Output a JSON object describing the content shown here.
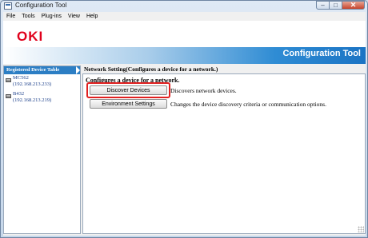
{
  "window": {
    "title": "Configuration Tool"
  },
  "title_controls": {
    "minimize": "–",
    "maximize": "□",
    "close": "✕"
  },
  "menu": {
    "items": [
      {
        "label": "File"
      },
      {
        "label": "Tools"
      },
      {
        "label": "Plug-ins"
      },
      {
        "label": "View"
      },
      {
        "label": "Help"
      }
    ]
  },
  "banner": {
    "logo": "OKI",
    "title": "Configuration Tool",
    "logo_color": "#e0001b",
    "accent_color": "#1b74c4"
  },
  "device_table": {
    "header": "Registered Device Table",
    "devices": [
      {
        "name": "MC562",
        "ip": "(192.168.213.233)",
        "icon": "printer-icon"
      },
      {
        "name": "B432",
        "ip": "(192.168.213.219)",
        "icon": "printer-icon"
      }
    ]
  },
  "main": {
    "section_title": "Network Setting(Configures a device for a network.)",
    "heading": "Configures a device for a network.",
    "actions": [
      {
        "label": "Discover Devices",
        "description": "Discovers network devices."
      },
      {
        "label": "Environment Settings",
        "description": "Changes the device discovery criteria or communication options."
      }
    ]
  }
}
